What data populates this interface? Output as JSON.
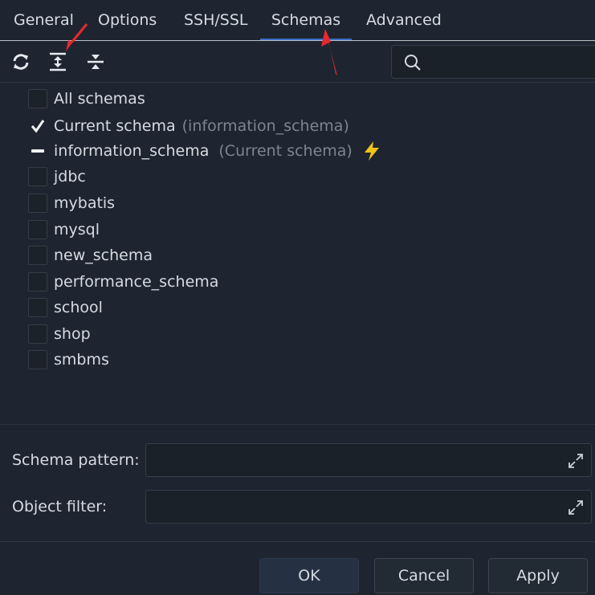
{
  "tabs": [
    {
      "label": "General"
    },
    {
      "label": "Options"
    },
    {
      "label": "SSH/SSL"
    },
    {
      "label": "Schemas",
      "active": true
    },
    {
      "label": "Advanced"
    }
  ],
  "toolbar": {
    "icons": [
      "refresh-icon",
      "expand-all-icon",
      "collapse-all-icon"
    ]
  },
  "search": {
    "placeholder": "",
    "icon": "search-icon"
  },
  "schemas": {
    "all": {
      "label": "All schemas",
      "checked": false
    },
    "current": {
      "label": "Current schema",
      "note": "(information_schema)",
      "checked": true
    },
    "information": {
      "label": "information_schema",
      "note": "(Current schema)",
      "state": "indeterminate",
      "icon": "lightning-icon"
    },
    "items": [
      {
        "label": "jdbc"
      },
      {
        "label": "mybatis"
      },
      {
        "label": "mysql"
      },
      {
        "label": "new_schema"
      },
      {
        "label": "performance_schema"
      },
      {
        "label": "school"
      },
      {
        "label": "shop"
      },
      {
        "label": "smbms"
      }
    ]
  },
  "fields": {
    "schema_pattern_label": "Schema pattern:",
    "schema_pattern_value": "",
    "object_filter_label": "Object filter:",
    "object_filter_value": ""
  },
  "buttons": {
    "ok": "OK",
    "cancel": "Cancel",
    "apply": "Apply"
  },
  "colors": {
    "annotation": "#e8292b",
    "accent": "#3d6fc4",
    "lightning": "#f0c419"
  }
}
